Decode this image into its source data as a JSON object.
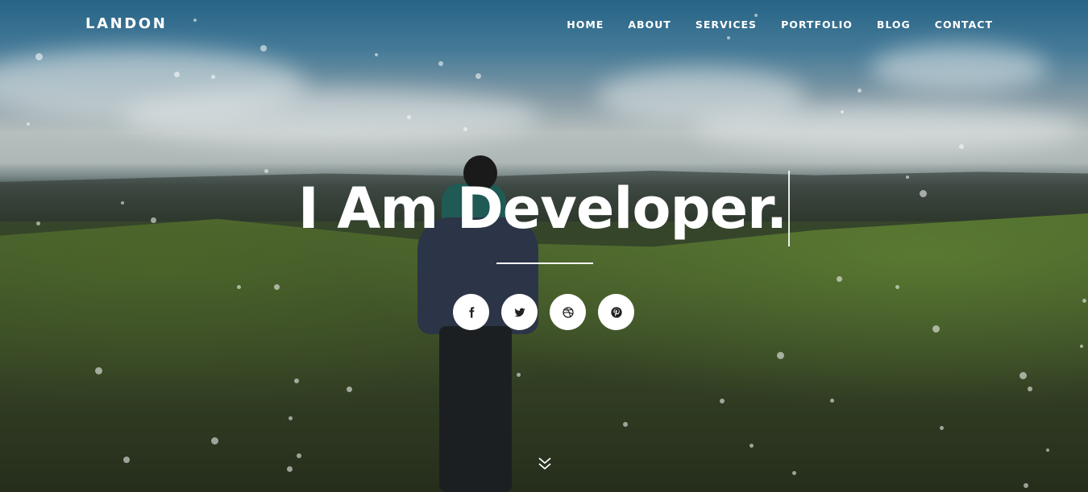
{
  "brand": {
    "name": "LANDON"
  },
  "nav": {
    "items": [
      {
        "label": "HOME"
      },
      {
        "label": "ABOUT"
      },
      {
        "label": "SERVICES"
      },
      {
        "label": "PORTFOLIO"
      },
      {
        "label": "BLOG"
      },
      {
        "label": "CONTACT"
      }
    ]
  },
  "hero": {
    "headline": "I Am Developer."
  },
  "social": [
    {
      "icon": "facebook-icon"
    },
    {
      "icon": "twitter-icon"
    },
    {
      "icon": "dribbble-icon"
    },
    {
      "icon": "pinterest-icon"
    }
  ],
  "scroll": {
    "icon": "chevron-double-down-icon"
  }
}
